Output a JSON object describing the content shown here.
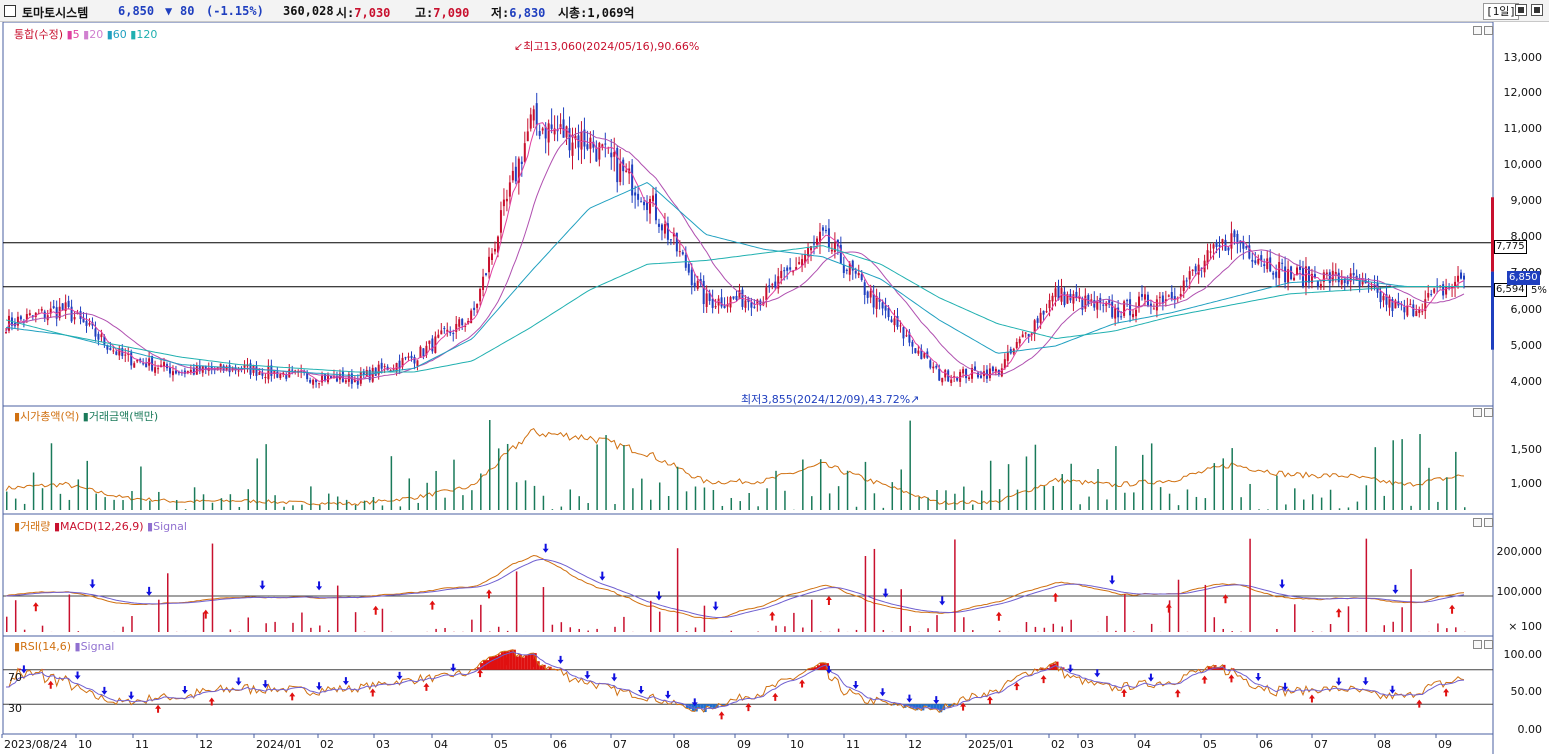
{
  "header": {
    "stock_name": "토마토시스템",
    "price": "6,850",
    "change_arrow": "▼",
    "change": "80",
    "change_pct": "(-1.15%)",
    "volume": "360,028",
    "open_label": "시:",
    "open_value": "7,030",
    "high_label": "고:",
    "high_value": "7,090",
    "low_label": "저:",
    "low_value": "6,830",
    "cap_label": "시총:",
    "cap_value": "1,069억",
    "period": "[1일]",
    "colors": {
      "up": "#c8102e",
      "down": "#1f3fbf"
    }
  },
  "legends": {
    "price": {
      "main": "통합(수정)",
      "ma5": "5",
      "ma20": "20",
      "ma60": "60",
      "ma120": "120"
    },
    "cap": {
      "cap": "시가총액(억)",
      "amount": "거래금액(백만)"
    },
    "macd": {
      "volume": "거래량",
      "macd": "MACD(12,26,9)",
      "signal": "Signal"
    },
    "rsi": {
      "rsi": "RSI(14,6)",
      "signal": "Signal"
    }
  },
  "annotations": {
    "max": "최고13,060(2024/05/16),90.66%",
    "min": "최저3,855(2024/12/09),43.72%"
  },
  "price_boxes": {
    "line1": "7,775",
    "line2": "6,594",
    "current": "6,850",
    "pct": "5%"
  },
  "y_axes": {
    "price": [
      "13,000",
      "12,000",
      "11,000",
      "10,000",
      "9,000",
      "8,000",
      "7,000",
      "6,000",
      "5,000",
      "4,000"
    ],
    "cap": [
      "1,500",
      "1,000"
    ],
    "macd": [
      "200,000",
      "100,000",
      "× 100"
    ],
    "rsi": [
      "100.00",
      "50.00",
      "0.00"
    ],
    "rsi_levels": [
      "70",
      "30"
    ]
  },
  "x_axis": [
    "2023/08/24",
    "10",
    "11",
    "12",
    "2024/01",
    "02",
    "03",
    "04",
    "05",
    "06",
    "07",
    "08",
    "09",
    "10",
    "11",
    "12",
    "2025/01",
    "02",
    "03",
    "04",
    "05",
    "06",
    "07",
    "08",
    "09"
  ],
  "chart_data": {
    "type": "line",
    "title": "",
    "x": [
      "2023/08",
      "2023/09",
      "2023/10",
      "2023/11",
      "2023/12",
      "2024/01",
      "2024/02",
      "2024/03",
      "2024/04",
      "2024/05",
      "2024/06",
      "2024/07",
      "2024/08",
      "2024/09",
      "2024/10",
      "2024/11",
      "2024/12",
      "2025/01",
      "2025/02",
      "2025/03",
      "2025/04",
      "2025/05",
      "2025/06",
      "2025/07",
      "2025/08",
      "2025/09"
    ],
    "series": [
      {
        "name": "통합(수정)",
        "values": [
          5600,
          6000,
          4700,
          4300,
          4400,
          4200,
          4100,
          4700,
          5800,
          11000,
          10500,
          9000,
          6200,
          6300,
          7900,
          6000,
          4200,
          4300,
          6400,
          5900,
          6400,
          7900,
          6900,
          6800,
          5900,
          6850
        ]
      },
      {
        "name": "60",
        "values": [
          5500,
          5300,
          4900,
          4500,
          4400,
          4300,
          4200,
          4400,
          5200,
          7000,
          8700,
          9400,
          8000,
          7600,
          7400,
          6800,
          5700,
          4800,
          5000,
          5600,
          5900,
          6300,
          6700,
          6800,
          6600,
          6600
        ]
      },
      {
        "name": "120",
        "values": [
          5700,
          5300,
          5000,
          4700,
          4500,
          4400,
          4300,
          4300,
          4600,
          5500,
          6500,
          7200,
          7300,
          7500,
          7700,
          7200,
          6300,
          5600,
          5200,
          5400,
          5800,
          6100,
          6400,
          6500,
          6600,
          6600
        ]
      }
    ],
    "ylim": [
      3600,
      13500
    ],
    "hlines": [
      7775,
      6594
    ],
    "markers": {
      "high": 13060,
      "low": 3855
    }
  }
}
